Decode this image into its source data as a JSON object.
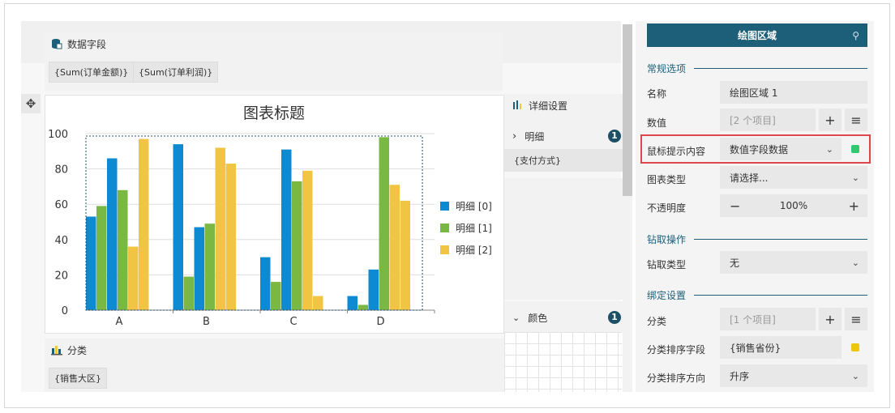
{
  "data_fields": {
    "title": "数据字段",
    "chips": [
      "{Sum(订单金额)}",
      "{Sum(订单利润)}"
    ]
  },
  "category": {
    "title": "分类",
    "chip": "{销售大区}"
  },
  "detail_panel": {
    "title": "详细设置",
    "detail_label": "明细",
    "detail_count": "1",
    "detail_chip": "{支付方式}",
    "color_label": "颜色",
    "color_count": "1"
  },
  "side": {
    "title": "绘图区域",
    "sections": {
      "general": "常规选项",
      "drill": "钻取操作",
      "binding": "绑定设置"
    },
    "props": {
      "name_label": "名称",
      "name_value": "绘图区域 1",
      "values_label": "数值",
      "values_value": "[2 个项目]",
      "tooltip_label": "鼠标提示内容",
      "tooltip_value": "数值字段数据",
      "chart_type_label": "图表类型",
      "chart_type_value": "请选择...",
      "opacity_label": "不透明度",
      "opacity_value": "100%",
      "drill_type_label": "钻取类型",
      "drill_type_value": "无",
      "category_label": "分类",
      "category_value": "[1 个项目]",
      "sort_field_label": "分类排序字段",
      "sort_field_value": "{销售省份}",
      "sort_dir_label": "分类排序方向",
      "sort_dir_value": "升序"
    },
    "colors": {
      "tooltip_swatch": "#2ecc71",
      "sort_swatch": "#f1c40f"
    }
  },
  "chart_data": {
    "type": "bar",
    "title": "图表标题",
    "categories": [
      "A",
      "B",
      "C",
      "D"
    ],
    "series": [
      {
        "name": "明细 [0]",
        "color": "#0e8ad3",
        "values": [
          53,
          94,
          30,
          8
        ]
      },
      {
        "name": "明细 [1]",
        "color": "#79b842",
        "values": [
          59,
          19,
          16,
          3
        ]
      },
      {
        "name": "明细 [0]",
        "color": "#0e8ad3",
        "values": [
          86,
          47,
          91,
          23
        ]
      },
      {
        "name": "明细 [1]",
        "color": "#79b842",
        "values": [
          68,
          49,
          73,
          98
        ]
      },
      {
        "name": "明细 [2]",
        "color": "#f2c443",
        "values": [
          36,
          92,
          79,
          71
        ]
      },
      {
        "name": "明细 [2]",
        "color": "#f2c443",
        "values": [
          97,
          83,
          8,
          62
        ]
      }
    ],
    "legend": [
      {
        "name": "明细 [0]",
        "color": "#0e8ad3"
      },
      {
        "name": "明细 [1]",
        "color": "#79b842"
      },
      {
        "name": "明细 [2]",
        "color": "#f2c443"
      }
    ],
    "yticks": [
      "0",
      "20",
      "40",
      "60",
      "80",
      "100"
    ],
    "ylim": [
      0,
      100
    ],
    "grid": true,
    "legend_position": "right"
  }
}
